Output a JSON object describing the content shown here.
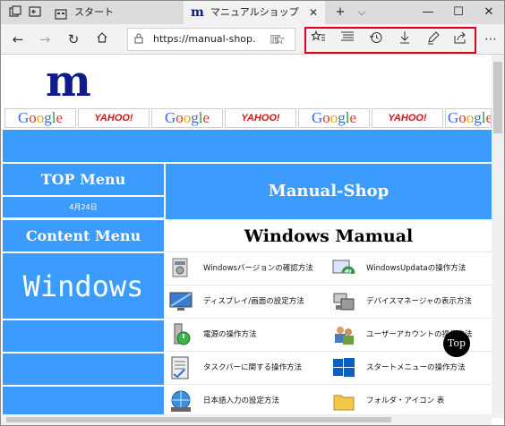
{
  "browser": {
    "tabs": [
      {
        "label": "スタート",
        "active": false
      },
      {
        "label": "マニュアルショップ",
        "active": true
      }
    ],
    "address": {
      "url": "https://manual-shop."
    },
    "toolbar_icons": [
      "favorites-add-icon",
      "hub-icon",
      "history-icon",
      "download-icon",
      "pen-icon",
      "share-icon"
    ],
    "highlight_color": "#e0001b"
  },
  "page": {
    "logo": "m",
    "ads": [
      "Google",
      "YAHOO!",
      "Google",
      "YAHOO!",
      "Google",
      "YAHOO!",
      "Google"
    ],
    "ad_yahoo_sub": "JAPAN",
    "sidebar": {
      "top_menu": "TOP Menu",
      "date": "4月24日",
      "content_menu": "Content Menu",
      "windows": "Windows"
    },
    "header": "Manual-Shop",
    "section_title": "Windows Mamual",
    "items": [
      {
        "label": "Windowsバージョンの確認方法",
        "icon": "windows-version-icon"
      },
      {
        "label": "WindowsUpdataの操作方法",
        "icon": "windows-update-icon"
      },
      {
        "label": "ディスプレイ/画面の設定方法",
        "icon": "display-icon"
      },
      {
        "label": "デバイスマネージャの表示方法",
        "icon": "device-manager-icon"
      },
      {
        "label": "電源の操作方法",
        "icon": "power-icon"
      },
      {
        "label": "ユーザーアカウントの操作方法",
        "icon": "user-account-icon"
      },
      {
        "label": "タスクバーに関する操作方法",
        "icon": "taskbar-icon"
      },
      {
        "label": "スタートメニューの操作方法",
        "icon": "start-menu-icon"
      },
      {
        "label": "日本語入力の設定方法",
        "icon": "ime-icon"
      },
      {
        "label": "フォルダ・アイコン 表",
        "icon": "folder-icon"
      }
    ],
    "top_button": "Top",
    "accent": "#3b9cfe"
  }
}
